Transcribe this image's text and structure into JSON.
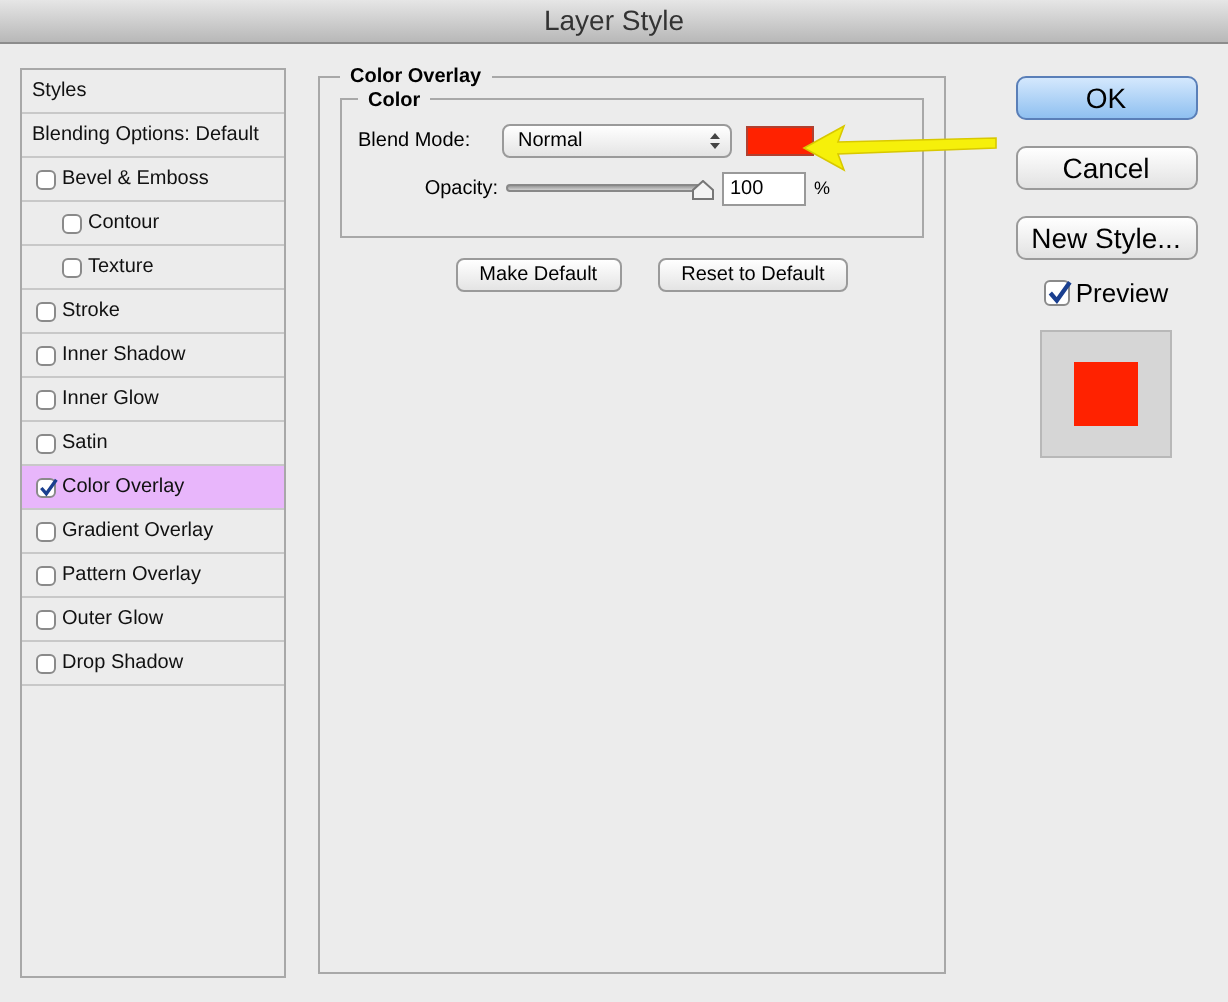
{
  "window": {
    "title": "Layer Style"
  },
  "styles": [
    {
      "kind": "header",
      "label": "Styles",
      "selected": false
    },
    {
      "kind": "header",
      "label": "Blending Options: Default",
      "selected": false
    },
    {
      "kind": "checkbox",
      "label": "Bevel & Emboss",
      "checked": false,
      "selected": false,
      "children": [
        {
          "kind": "checkbox",
          "label": "Contour",
          "checked": false,
          "selected": false
        },
        {
          "kind": "checkbox",
          "label": "Texture",
          "checked": false,
          "selected": false
        }
      ]
    },
    {
      "kind": "checkbox",
      "label": "Stroke",
      "checked": false,
      "selected": false
    },
    {
      "kind": "checkbox",
      "label": "Inner Shadow",
      "checked": false,
      "selected": false
    },
    {
      "kind": "checkbox",
      "label": "Inner Glow",
      "checked": false,
      "selected": false
    },
    {
      "kind": "checkbox",
      "label": "Satin",
      "checked": false,
      "selected": false
    },
    {
      "kind": "checkbox",
      "label": "Color Overlay",
      "checked": true,
      "selected": true
    },
    {
      "kind": "checkbox",
      "label": "Gradient Overlay",
      "checked": false,
      "selected": false
    },
    {
      "kind": "checkbox",
      "label": "Pattern Overlay",
      "checked": false,
      "selected": false
    },
    {
      "kind": "checkbox",
      "label": "Outer Glow",
      "checked": false,
      "selected": false
    },
    {
      "kind": "checkbox",
      "label": "Drop Shadow",
      "checked": false,
      "selected": false
    }
  ],
  "panel": {
    "title": "Color Overlay",
    "group_title": "Color",
    "blend_mode": {
      "label": "Blend Mode:",
      "value": "Normal",
      "color": "#ff2200"
    },
    "opacity": {
      "label": "Opacity:",
      "level": 1,
      "value": "100",
      "unit": "%"
    },
    "buttons": [
      "Make Default",
      "Reset to Default"
    ]
  },
  "actions": [
    {
      "label": "OK",
      "default": true
    },
    {
      "label": "Cancel",
      "default": false
    },
    {
      "label": "New Style...",
      "default": false
    }
  ],
  "preview": {
    "label": "Preview",
    "checked": true,
    "color": "#ff2200"
  }
}
